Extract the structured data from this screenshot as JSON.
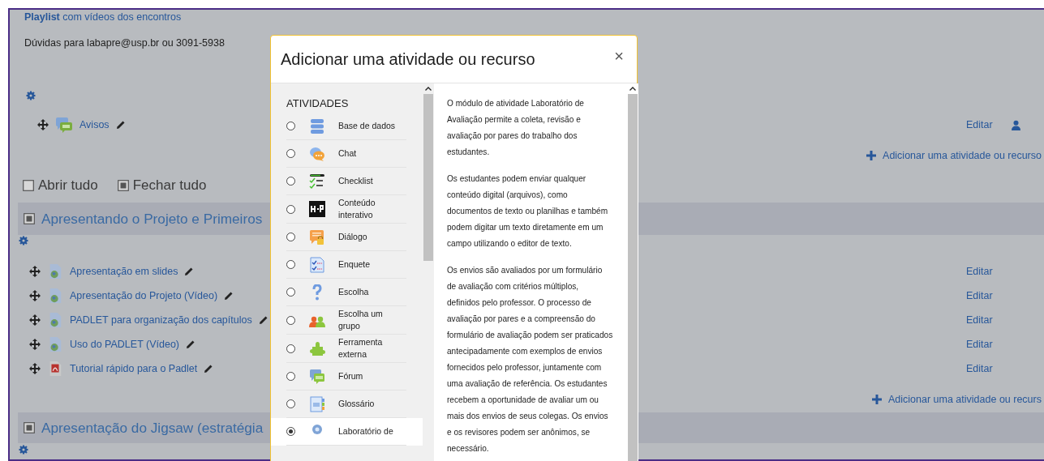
{
  "page": {
    "playlist_link": "**Playlist** com vídeos dos encontros",
    "contact": "Dúvidas para labapre@usp.br ou 3091-5938",
    "announcements": {
      "kind": "forum",
      "title": "Avisos",
      "edit": "Editar"
    },
    "add_activity": "Adicionar uma atividade ou recurso",
    "toggles": [
      {
        "label": "Abrir tudo",
        "checked": false
      },
      {
        "label": "Fechar tudo",
        "checked": true
      }
    ],
    "sections": [
      {
        "title": "Apresentando o Projeto e Primeiros",
        "items": [
          {
            "kind": "url",
            "title": "Apresentação em slides",
            "edit": "Editar"
          },
          {
            "kind": "url",
            "title": "Apresentação do Projeto (Vídeo)",
            "edit": "Editar"
          },
          {
            "kind": "url",
            "title": "PADLET para organização dos capítulos",
            "edit": "Editar"
          },
          {
            "kind": "url",
            "title": "Uso do PADLET (Vídeo)",
            "edit": "Editar"
          },
          {
            "kind": "pdf",
            "title": "Tutorial rápido para o Padlet",
            "edit": "Editar"
          }
        ],
        "add_activity": "Adicionar uma atividade ou recurs"
      },
      {
        "title": "Apresentação do Jigsaw (estratégia"
      }
    ]
  },
  "modal": {
    "title": "Adicionar uma atividade ou recurso",
    "close": "×",
    "category": "ATIVIDADES",
    "items": [
      {
        "kind": "database",
        "label": "Base de dados",
        "selected": false
      },
      {
        "kind": "chat",
        "label": "Chat",
        "selected": false
      },
      {
        "kind": "checklist",
        "label": "Checklist",
        "selected": false
      },
      {
        "kind": "h5p",
        "label": "Conteúdo interativo",
        "selected": false
      },
      {
        "kind": "dialogue",
        "label": "Diálogo",
        "selected": false
      },
      {
        "kind": "survey",
        "label": "Enquete",
        "selected": false
      },
      {
        "kind": "choice",
        "label": "Escolha",
        "selected": false
      },
      {
        "kind": "group",
        "label": "Escolha um grupo",
        "selected": false
      },
      {
        "kind": "lti",
        "label": "Ferramenta externa",
        "selected": false
      },
      {
        "kind": "forum",
        "label": "Fórum",
        "selected": false
      },
      {
        "kind": "glossary",
        "label": "Glossário",
        "selected": false
      },
      {
        "kind": "workshop",
        "label": "Laboratório de",
        "selected": true
      }
    ],
    "description": [
      "O módulo de atividade Laboratório de Avaliação permite a coleta, revisão e avaliação por pares do trabalho dos estudantes.",
      "Os estudantes podem enviar qualquer conteúdo digital (arquivos), como documentos de texto ou planilhas e também podem digitar um texto diretamente em um campo utilizando o editor de texto.",
      "Os envios são avaliados por um formulário de avaliação com critérios múltiplos, definidos pelo professor. O processo de avaliação por pares e a compreensão do formulário de avaliação podem ser praticados antecipadamente com exemplos de envios fornecidos pelo professor, juntamente com uma avaliação de referência. Os estudantes recebem a oportunidade de avaliar um ou mais dos envios de seus colegas. Os envios e os revisores podem ser anônimos, se necessário."
    ]
  }
}
